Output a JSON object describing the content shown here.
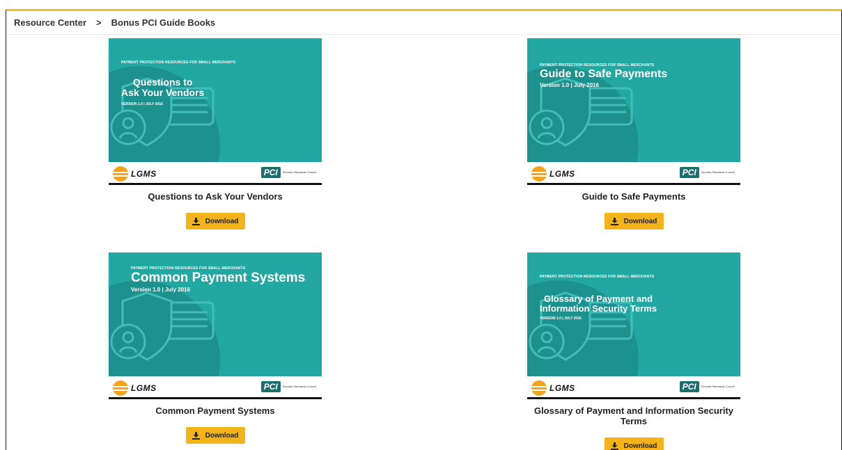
{
  "breadcrumb": {
    "root": "Resource Center",
    "separator": ">",
    "current": "Bonus PCI Guide Books"
  },
  "colors": {
    "accent": "#f2c02b",
    "cover_teal": "#22a7a2",
    "button": "#f3b41a"
  },
  "cards": [
    {
      "title": "Questions to Ask Your Vendors",
      "cover_eyebrow": "PAYMENT PROTECTION RESOURCES FOR SMALL MERCHANTS",
      "cover_title_line1": "Questions to",
      "cover_title_line2": "Ask Your Vendors",
      "cover_version": "VERSION 1.0  |  JULY 2016",
      "logo_left": "LGMS",
      "logo_right": "PCI",
      "logo_right_caption": "Security Standards Council",
      "button_label": "Download"
    },
    {
      "title": "Guide to Safe Payments",
      "cover_eyebrow": "PAYMENT PROTECTION RESOURCES FOR SMALL MERCHANTS",
      "cover_title_line1": "Guide to Safe Payments",
      "cover_title_line2": "",
      "cover_version": "Version 1.0 | July 2016",
      "logo_left": "LGMS",
      "logo_right": "PCI",
      "logo_right_caption": "Security Standards Council",
      "button_label": "Download"
    },
    {
      "title": "Common Payment Systems",
      "cover_eyebrow": "PAYMENT PROTECTION RESOURCES FOR SMALL MERCHANTS",
      "cover_title_line1": "Common Payment Systems",
      "cover_title_line2": "",
      "cover_version": "Version 1.0 | July 2016",
      "logo_left": "LGMS",
      "logo_right": "PCI",
      "logo_right_caption": "Security Standards Council",
      "button_label": "Download"
    },
    {
      "title": "Glossary of Payment and Information Security Terms",
      "cover_eyebrow": "PAYMENT PROTECTION RESOURCES FOR SMALL MERCHANTS",
      "cover_title_line1": "Glossary of Payment and",
      "cover_title_line2": "Information Security Terms",
      "cover_version": "VERSION 1.0  |  JULY 2016",
      "logo_left": "LGMS",
      "logo_right": "PCI",
      "logo_right_caption": "Security Standards Council",
      "button_label": "Download"
    }
  ]
}
